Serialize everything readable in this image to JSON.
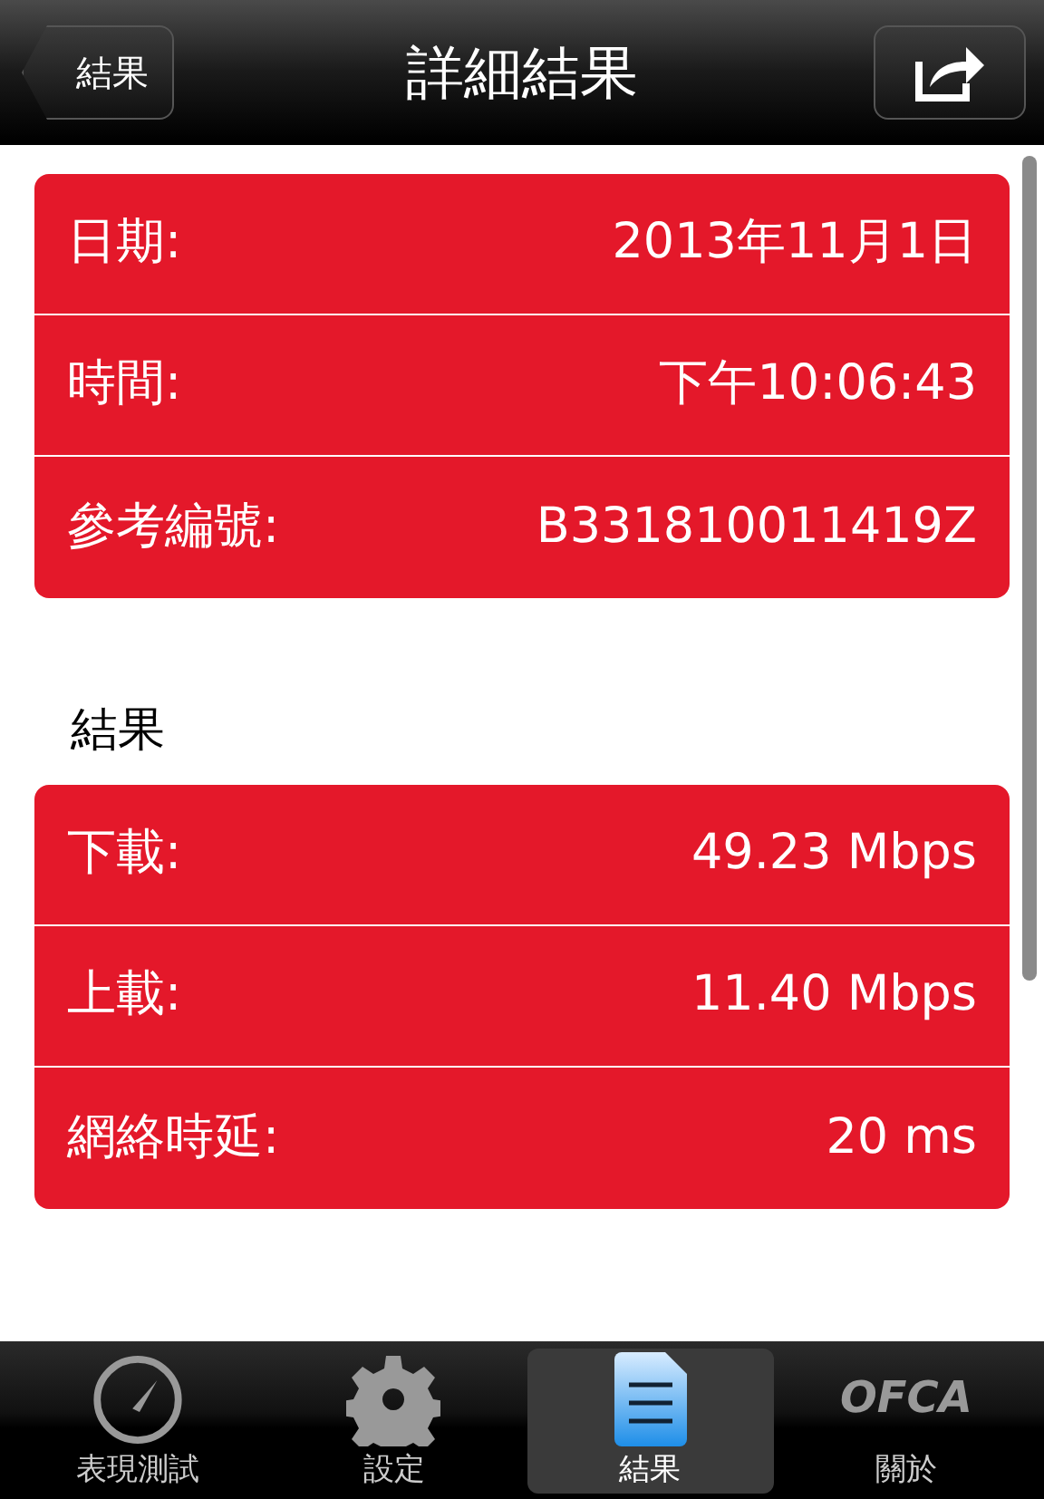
{
  "navbar": {
    "back_button": "結果",
    "title": "詳細結果"
  },
  "groups": [
    {
      "rows": [
        {
          "label": "日期:",
          "value": "2013年11月1日"
        },
        {
          "label": "時間:",
          "value": "下午10:06:43"
        },
        {
          "label": "參考編號:",
          "value": "B331810011419Z"
        }
      ]
    },
    {
      "header": "結果",
      "rows": [
        {
          "label": "下載:",
          "value": "49.23 Mbps"
        },
        {
          "label": "上載:",
          "value": "11.40 Mbps"
        },
        {
          "label": "網絡時延:",
          "value": "20 ms"
        }
      ]
    }
  ],
  "tab_bar": [
    {
      "kind": "gauge",
      "label": "表現測試",
      "selected": false
    },
    {
      "kind": "gear",
      "label": "設定",
      "selected": false
    },
    {
      "kind": "document",
      "label": "結果",
      "selected": true
    },
    {
      "kind": "logo",
      "logo_text": "OFCA",
      "label": "關於",
      "selected": false
    }
  ]
}
